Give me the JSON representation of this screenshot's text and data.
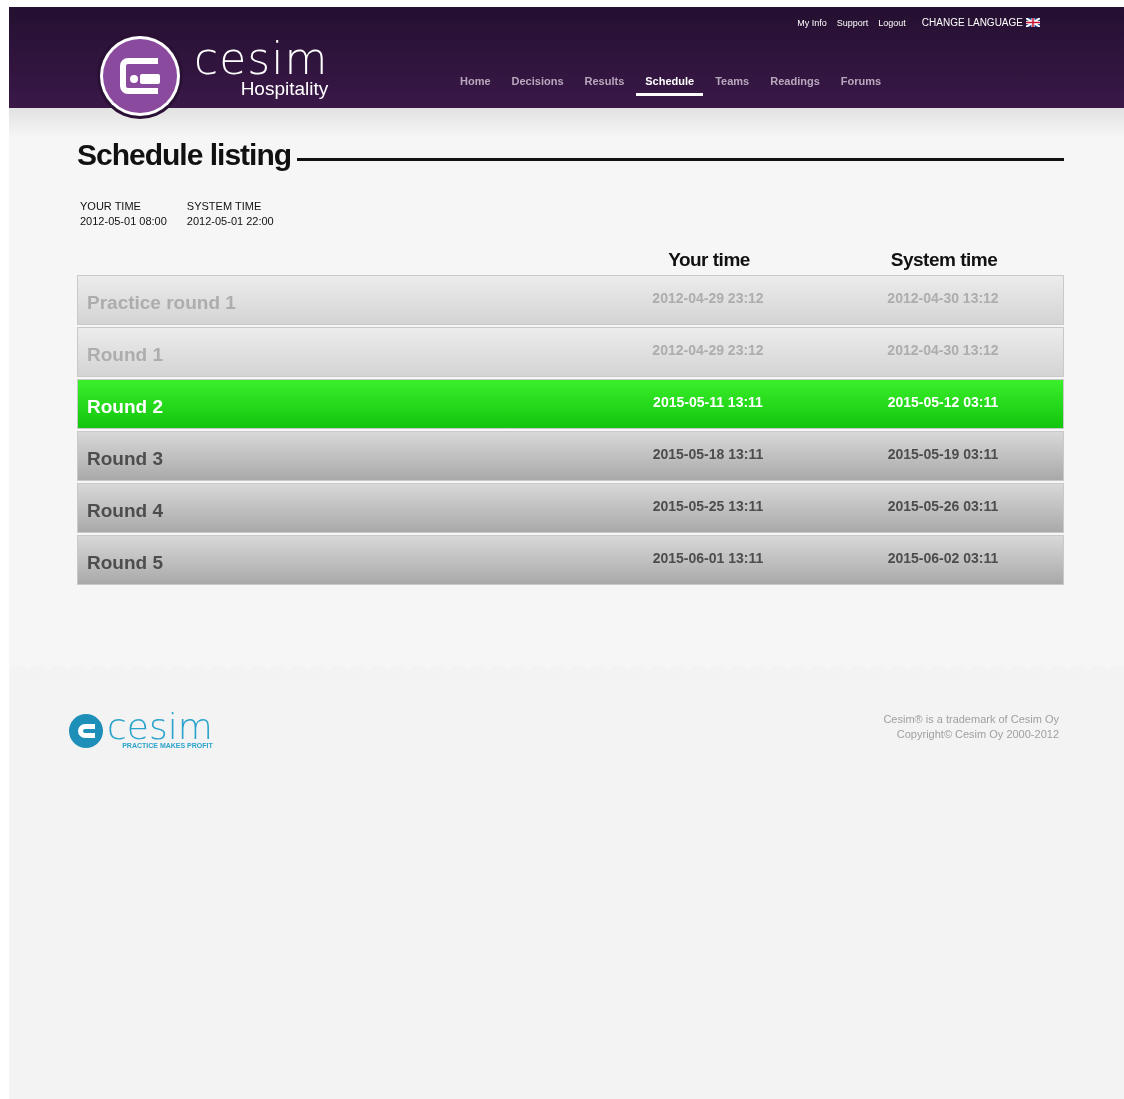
{
  "header": {
    "logo": {
      "brand": "cesim",
      "product": "Hospitality"
    },
    "top_links": [
      {
        "label": "My Info"
      },
      {
        "label": "Support"
      },
      {
        "label": "Logout"
      },
      {
        "label": "CHANGE LANGUAGE"
      }
    ],
    "nav": [
      {
        "label": "Home",
        "selected": false
      },
      {
        "label": "Decisions",
        "selected": false
      },
      {
        "label": "Results",
        "selected": false
      },
      {
        "label": "Schedule",
        "selected": true
      },
      {
        "label": "Teams",
        "selected": false
      },
      {
        "label": "Readings",
        "selected": false
      },
      {
        "label": "Forums",
        "selected": false
      }
    ]
  },
  "title": "Schedule listing",
  "clock": [
    {
      "label": "YOUR TIME",
      "value": "2012-05-01 08:00"
    },
    {
      "label": "SYSTEM TIME",
      "value": "2012-05-01 22:00"
    }
  ],
  "table": {
    "columns": [
      "Your time",
      "System time"
    ],
    "rows": [
      {
        "name": "Practice round 1",
        "your_time": "2012-04-29 23:12",
        "system_time": "2012-04-30 13:12",
        "kind": "past"
      },
      {
        "name": "Round 1",
        "your_time": "2012-04-29 23:12",
        "system_time": "2012-04-30 13:12",
        "kind": "past"
      },
      {
        "name": "Round 2",
        "your_time": "2015-05-11 13:11",
        "system_time": "2015-05-12 03:11",
        "kind": "current"
      },
      {
        "name": "Round 3",
        "your_time": "2015-05-18 13:11",
        "system_time": "2015-05-19 03:11",
        "kind": "upcoming"
      },
      {
        "name": "Round 4",
        "your_time": "2015-05-25 13:11",
        "system_time": "2015-05-26 03:11",
        "kind": "upcoming"
      },
      {
        "name": "Round 5",
        "your_time": "2015-06-01 13:11",
        "system_time": "2015-06-02 03:11",
        "kind": "upcoming"
      }
    ]
  },
  "footer": {
    "logo": {
      "brand": "cesim",
      "tagline": "PRACTICE MAKES PROFIT"
    },
    "lines": [
      "Cesim® is a trademark of Cesim Oy",
      "Copyright© Cesim Oy 2000-2012"
    ]
  }
}
